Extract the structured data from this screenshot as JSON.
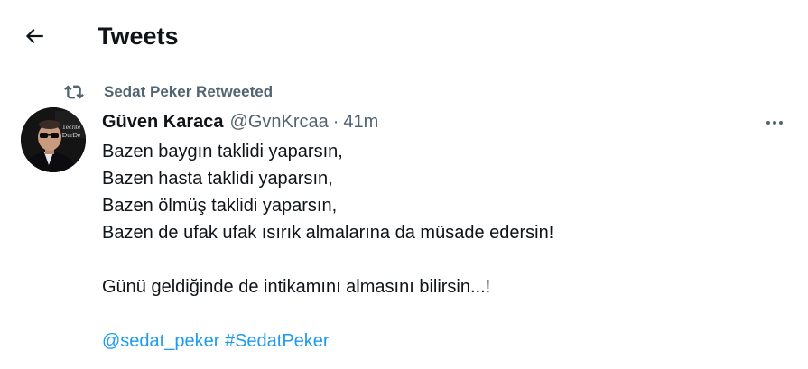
{
  "header": {
    "back_icon": "arrow-left-icon",
    "title": "Tweets"
  },
  "retweet_banner": {
    "icon": "retweet-icon",
    "text": "Sedat Peker Retweeted"
  },
  "tweet": {
    "avatar": {
      "overlay_text_line1": "Tecrite",
      "overlay_text_line2": "DurDe"
    },
    "author": {
      "display_name": "Güven Karaca",
      "handle": "@GvnKrcaa"
    },
    "separator": "·",
    "timestamp": "41m",
    "more_icon": "more-horizontal-icon",
    "body_lines": [
      "Bazen baygın taklidi yaparsın,",
      "Bazen hasta taklidi yaparsın,",
      "Bazen ölmüş taklidi yaparsın,",
      "Bazen de ufak ufak ısırık almalarına da müsade edersin!",
      "",
      "Günü geldiğinde de intikamını almasını bilirsin...!",
      ""
    ],
    "mention": "@sedat_peker",
    "hashtag": "#SedatPeker"
  },
  "colors": {
    "text_primary": "#0f1419",
    "text_secondary": "#536471",
    "link": "#1d9bf0",
    "background": "#ffffff"
  }
}
